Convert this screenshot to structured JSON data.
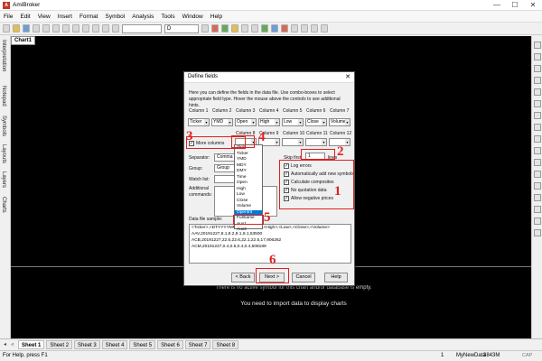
{
  "app": {
    "title": "AmiBroker",
    "icon_letter": "A",
    "window_buttons": [
      "—",
      "☐",
      "✕"
    ]
  },
  "menu": [
    "File",
    "Edit",
    "View",
    "Insert",
    "Format",
    "Symbol",
    "Analysis",
    "Tools",
    "Window",
    "Help"
  ],
  "toolbar": {
    "interval_value": "D"
  },
  "chart": {
    "tab_label": "Chart1",
    "no_symbol_text": "There is no active symbol for this chart and/or database is empty.",
    "import_text": "You need to import data to display charts"
  },
  "left_tabs": [
    "Interpretation",
    "Notepad",
    "Symbols",
    "Layouts",
    "Layers",
    "Charts"
  ],
  "sheets": [
    "Sheet 1",
    "Sheet 2",
    "Sheet 3",
    "Sheet 4",
    "Sheet 5",
    "Sheet 6",
    "Sheet 7",
    "Sheet 8"
  ],
  "status": {
    "help": "For Help, press F1",
    "mode": "1",
    "database": "MyNewData",
    "memory": "3843M",
    "cap": "CAP"
  },
  "dialog": {
    "title": "Define fields",
    "close": "✕",
    "description": "Here you can define the fields in the data file. Use combo-boxes to select appropriate field type. Hover the mouse above the controls to see additional hints.",
    "row1": [
      {
        "header": "Column 1",
        "value": "Ticker"
      },
      {
        "header": "Column 2",
        "value": "YMD"
      },
      {
        "header": "Column 3",
        "value": "Open"
      },
      {
        "header": "Column 4",
        "value": "High"
      },
      {
        "header": "Column 5",
        "value": "Low"
      },
      {
        "header": "Column 6",
        "value": "Close"
      },
      {
        "header": "Column 7",
        "value": "Volume"
      }
    ],
    "row2_headers": [
      "Column 8",
      "Column 9",
      "Column 10",
      "Column 11",
      "Column 12"
    ],
    "more_columns_label": "More columns",
    "skip_first_label": "Skip first",
    "skip_first_value": "1",
    "lines_label": "lines",
    "separator_label": "Separator:",
    "separator_value": "Comma (,)",
    "group_label": "Group:",
    "group_value": "Group 255",
    "watch_label": "Watch list:",
    "additional_label": "Additional",
    "commands_label": "commands:",
    "options": [
      {
        "label": "Log errors",
        "checked": true
      },
      {
        "label": "Automatically add new symbols",
        "checked": true
      },
      {
        "label": "Calculate composites",
        "checked": true
      },
      {
        "label": "No quotation data",
        "checked": true
      },
      {
        "label": "Allow negative prices",
        "checked": true
      }
    ],
    "sample_label": "Data file sample:",
    "sample_lines": [
      "<Ticker>,<DTYYYYMMDD>,<Open>,<High>,<Low>,<Close>,<Volume>",
      "AAV,20191227,8.1,8.2,8.1,8.1,53500",
      "ACB,20191227,22.6,22.6,22.1,22.5,17,906262",
      "ACM,20191227,0.4,0.5,0.4,0.4,508189"
    ],
    "buttons": {
      "back": "< Back",
      "next": "Next >",
      "cancel": "Cancel",
      "help": "Help"
    },
    "dropdown_options": [
      "Skip",
      "Ticker",
      "YMD",
      "MDY",
      "DMY",
      "Time",
      "Open",
      "High",
      "Low",
      "Close",
      "Volume",
      "OpenInt",
      "Fullname",
      "Aux1",
      "Aux2"
    ],
    "dropdown_selected": "OpenInt"
  },
  "annotations": {
    "numbers": [
      "1",
      "2",
      "3",
      "4",
      "5",
      "6"
    ],
    "color": "#e02020"
  }
}
